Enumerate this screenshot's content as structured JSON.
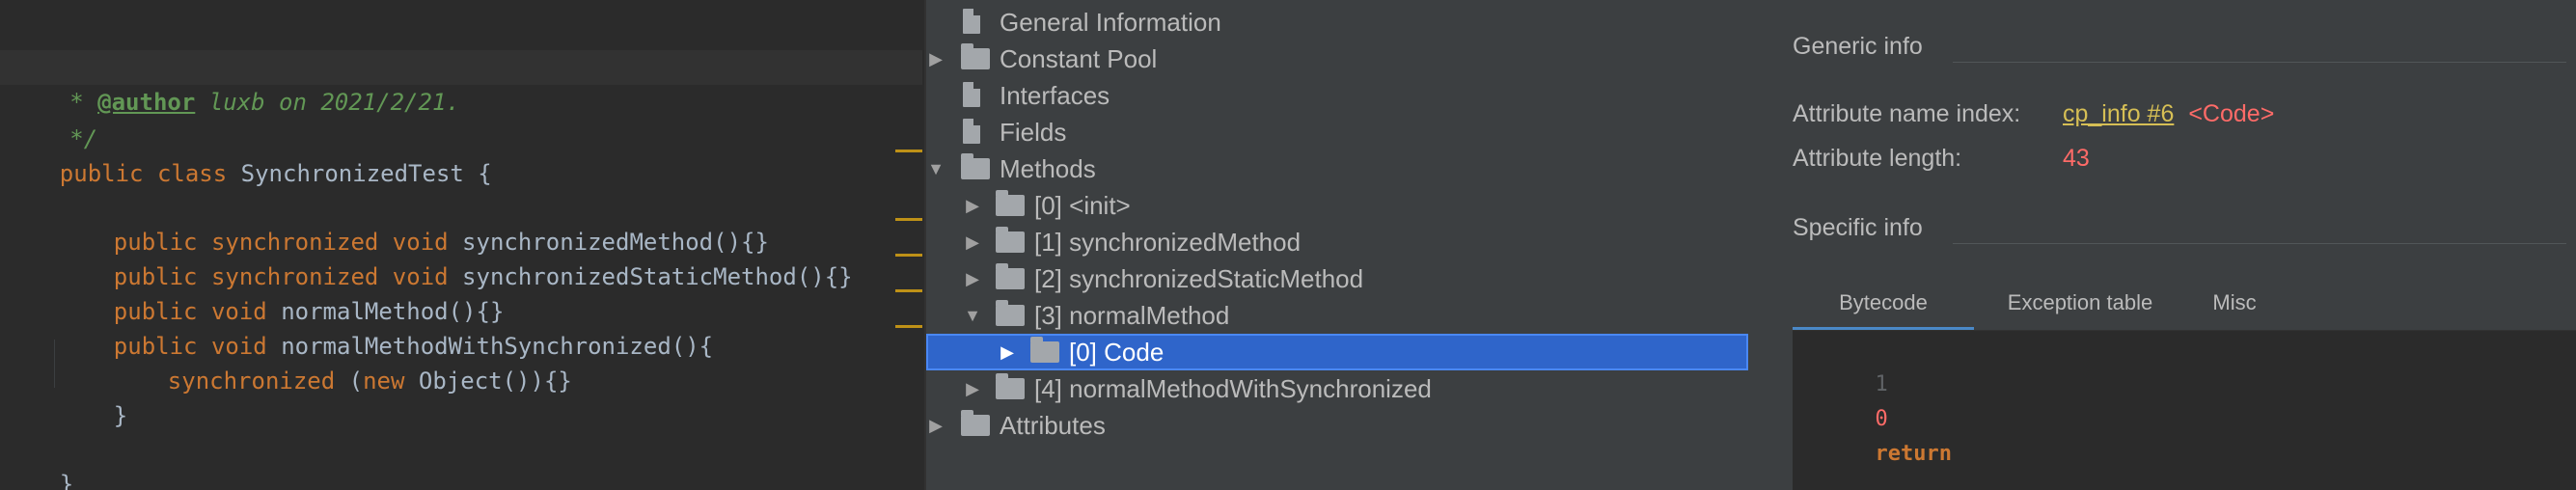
{
  "editor": {
    "lines": [
      {
        "text": "/**"
      },
      {
        "text": " * @author luxb on 2021/2/21."
      },
      {
        "text": " */"
      },
      {
        "text": "public class SynchronizedTest {"
      },
      {
        "text": ""
      },
      {
        "text": "public synchronized void synchronizedMethod(){}"
      },
      {
        "text": "public synchronized void synchronizedStaticMethod(){}"
      },
      {
        "text": "public void normalMethod(){}"
      },
      {
        "text": "public void normalMethodWithSynchronized(){"
      },
      {
        "text": "synchronized (new Object()){}"
      },
      {
        "text": "}"
      },
      {
        "text": ""
      },
      {
        "text": "}"
      }
    ],
    "tokens": {
      "comment_open": "/**",
      "comment_star": " * ",
      "author_tag": "@author",
      "author_text": " luxb on 2021/2/21.",
      "comment_close": " */",
      "kw_public": "public",
      "kw_class": "class",
      "kw_synchronized": "synchronized",
      "kw_void": "void",
      "kw_new": "new",
      "class_name": "SynchronizedTest",
      "brace_open": " {",
      "brace_close": "}",
      "m1": "synchronizedMethod",
      "m2": "synchronizedStaticMethod",
      "m3": "normalMethod",
      "m4": "normalMethodWithSynchronized",
      "empty_body": "(){}",
      "open_body": "(){",
      "sync_args": " (",
      "object_call": " Object()){}"
    }
  },
  "tree": {
    "items": [
      {
        "label": "General Information",
        "icon": "file-icon"
      },
      {
        "label": "Constant Pool",
        "icon": "folder-icon",
        "arrow": "▶"
      },
      {
        "label": "Interfaces",
        "icon": "file-icon"
      },
      {
        "label": "Fields",
        "icon": "file-icon"
      },
      {
        "label": "Methods",
        "icon": "folder-icon",
        "arrow": "▼"
      },
      {
        "label": "[0] <init>",
        "icon": "folder-icon",
        "arrow": "▶"
      },
      {
        "label": "[1] synchronizedMethod",
        "icon": "folder-icon",
        "arrow": "▶"
      },
      {
        "label": "[2] synchronizedStaticMethod",
        "icon": "folder-icon",
        "arrow": "▶"
      },
      {
        "label": "[3] normalMethod",
        "icon": "folder-icon",
        "arrow": "▼"
      },
      {
        "label": "[0] Code",
        "icon": "folder-icon",
        "arrow": "▶",
        "selected": true
      },
      {
        "label": "[4] normalMethodWithSynchronized",
        "icon": "folder-icon",
        "arrow": "▶"
      },
      {
        "label": "Attributes",
        "icon": "folder-icon",
        "arrow": "▶"
      }
    ]
  },
  "info": {
    "generic_title": "Generic info",
    "name_index_label": "Attribute name index:",
    "name_index_link": "cp_info #6",
    "name_index_value": "<Code>",
    "length_label": "Attribute length:",
    "length_value": "43",
    "specific_title": "Specific info",
    "tabs": [
      "Bytecode",
      "Exception table",
      "Misc"
    ],
    "bytecode": [
      {
        "line": "1",
        "offset": "0",
        "op": "return"
      }
    ]
  },
  "colors": {
    "editor_bg": "#2b2b2b",
    "panel_bg": "#3c3f41",
    "selection": "#2f65ca",
    "keyword": "#cc7832",
    "comment": "#629755",
    "link": "#d6bf55",
    "value_red": "#ff6b68"
  }
}
